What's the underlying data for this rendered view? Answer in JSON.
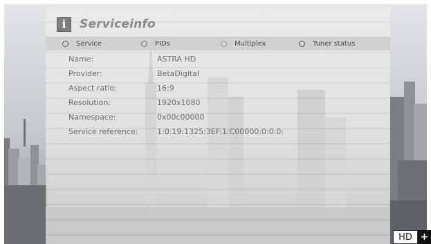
{
  "header": {
    "title": "Serviceinfo",
    "icon": "info-icon"
  },
  "tabs": [
    {
      "label": "Service",
      "icon": "radio-icon"
    },
    {
      "label": "PIDs",
      "icon": "radio-icon"
    },
    {
      "label": "Multiplex",
      "icon": "radio-icon"
    },
    {
      "label": "Tuner status",
      "icon": "radio-icon"
    }
  ],
  "info_rows": [
    {
      "label": "Name:",
      "value": "ASTRA HD"
    },
    {
      "label": "Provider:",
      "value": "BetaDigital"
    },
    {
      "label": "Aspect ratio:",
      "value": "16:9"
    },
    {
      "label": "Resolution:",
      "value": "1920x1080"
    },
    {
      "label": "Namespace:",
      "value": "0x00c00000"
    },
    {
      "label": "Service reference:",
      "value": "1:0:19:1325:3EF:1:C00000:0:0:0:"
    }
  ],
  "status_badges": {
    "hd": "HD",
    "plus": "+"
  }
}
